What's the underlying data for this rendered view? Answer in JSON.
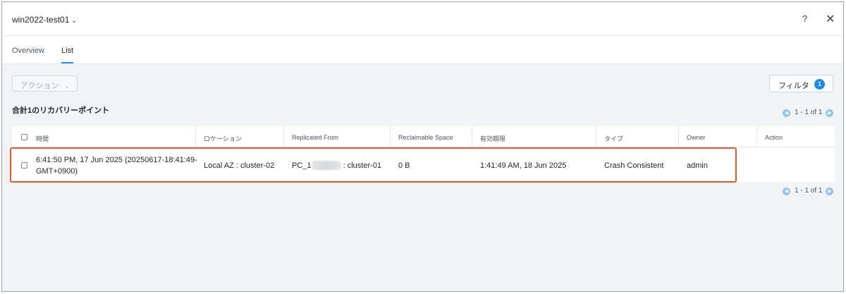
{
  "header": {
    "vm_name": "win2022-test01",
    "help_glyph": "?",
    "close_glyph": "✕"
  },
  "tabs": [
    {
      "label": "Overview",
      "active": false
    },
    {
      "label": "List",
      "active": true
    }
  ],
  "toolbar": {
    "action_label": "アクション",
    "filter_label": "フィルタ",
    "filter_count": "1"
  },
  "summary": {
    "total_label": "合計1のリカバリーポイント"
  },
  "pagination": {
    "top_label": "1 - 1 of 1",
    "bottom_label": "1 - 1 of 1"
  },
  "table": {
    "columns": [
      "時間",
      "ロケーション",
      "Replicated From",
      "Reclaimable Space",
      "有効期限",
      "タイプ",
      "Owner",
      "Action"
    ],
    "rows": [
      {
        "time_line1": "6:41:50 PM, 17 Jun 2025 (20250617-18:41:49-",
        "time_line2": "GMT+0900)",
        "location": "Local AZ : cluster-02",
        "replicated_from_prefix": "PC_1",
        "replicated_from_suffix": ": cluster-01",
        "reclaimable_space": "0 B",
        "expiry": "1:41:49 AM, 18 Jun 2025",
        "type": "Crash Consistent",
        "owner": "admin",
        "action": ""
      }
    ]
  },
  "colors": {
    "accent": "#1b8af3",
    "highlight_border": "#e8592c",
    "panel_bg": "#f2f3f5"
  }
}
